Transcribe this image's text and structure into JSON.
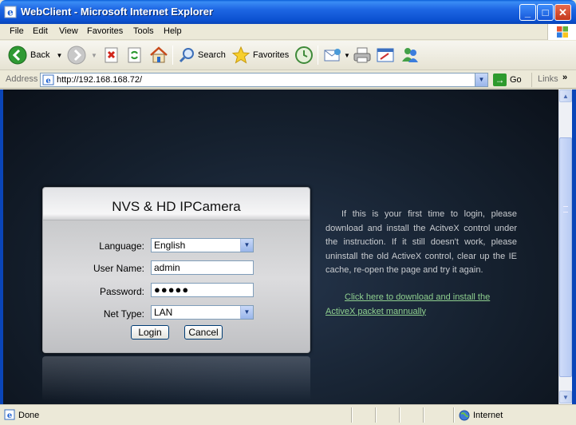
{
  "window": {
    "title": "WebClient - Microsoft Internet Explorer",
    "minimize": "_",
    "maximize": "□",
    "close": "✕"
  },
  "menu": [
    "File",
    "Edit",
    "View",
    "Favorites",
    "Tools",
    "Help"
  ],
  "toolbar": {
    "back": "Back",
    "search": "Search",
    "favorites": "Favorites"
  },
  "address": {
    "label": "Address",
    "url": "http://192.168.168.72/",
    "go": "Go",
    "links": "Links",
    "more": "»"
  },
  "login": {
    "title": "NVS & HD IPCamera",
    "language_label": "Language:",
    "language_value": "English",
    "username_label": "User Name:",
    "username_value": "admin",
    "password_label": "Password:",
    "password_value": "●●●●●",
    "nettype_label": "Net  Type:",
    "nettype_value": "LAN",
    "login_button": "Login",
    "cancel_button": "Cancel"
  },
  "info": {
    "text": "If this is your first time to login, please download and install the AcitveX control under the instruction. If it still doesn't work, please uninstall the old ActiveX control, clear up the IE cache, re-open the page and try it again.",
    "link_line1": "Click here to download and install the",
    "link_line2": "ActiveX packet mannually"
  },
  "status": {
    "text": "Done",
    "zone": "Internet"
  }
}
